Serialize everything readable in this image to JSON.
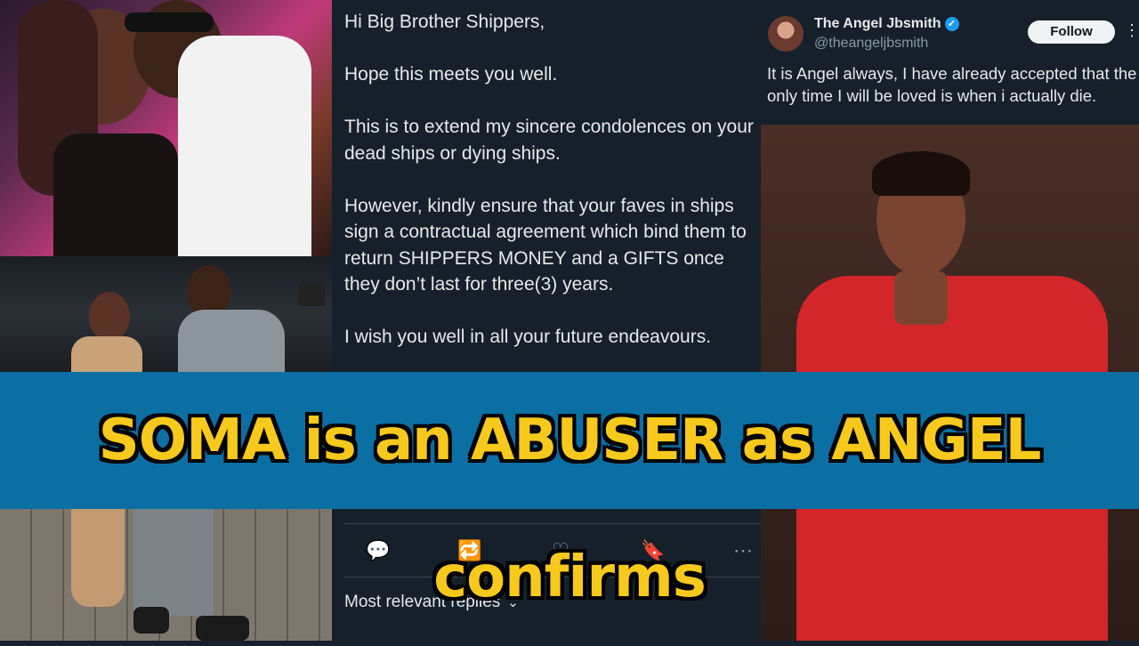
{
  "main_tweet": {
    "text": "Hi Big Brother Shippers,\n\nHope this meets you well.\n\nThis is to extend my sincere condolences on your dead ships or dying ships.\n\nHowever, kindly ensure that your faves in ships sign a contractual agreement which bind them to return SHIPPERS MONEY and a GIFTS once they don’t last for three(3) years.\n\nI wish you well in all your future endeavours.",
    "actions": [
      {
        "icon": "reply-icon",
        "glyph": "💬"
      },
      {
        "icon": "retweet-icon",
        "glyph": "🔁"
      },
      {
        "icon": "like-icon",
        "glyph": "♡"
      },
      {
        "icon": "bookmark-icon",
        "glyph": "🔖"
      },
      {
        "icon": "share-icon",
        "glyph": "⋯"
      }
    ],
    "replies_filter": "Most relevant replies"
  },
  "right_tweet": {
    "display_name": "The Angel Jbsmith",
    "handle": "@theangeljbsmith",
    "follow_label": "Follow",
    "text": "It is Angel always, I have already accepted that the only time I will be loved is when i actually die."
  },
  "banner": {
    "text": "SOMA is an ABUSER as ANGEL confirms",
    "background": "#0b6fa4",
    "text_color": "#f7c91c"
  }
}
